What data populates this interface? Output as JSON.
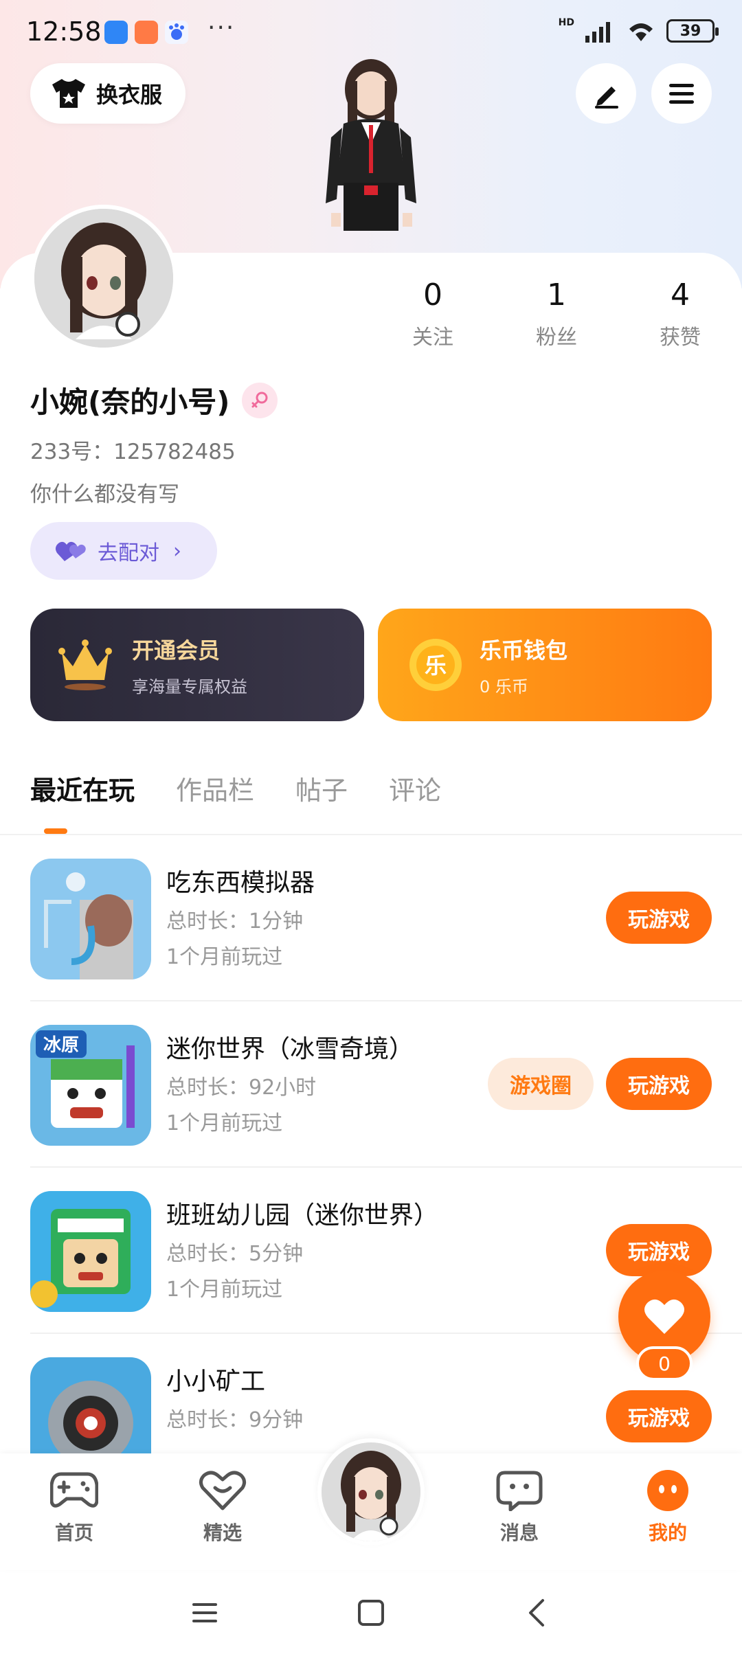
{
  "status_bar": {
    "time": "12:58",
    "dots": "···",
    "network": "HD",
    "battery": "39"
  },
  "header": {
    "dress_button": "换衣服",
    "edit_icon": "edit-icon",
    "menu_icon": "menu-icon"
  },
  "profile": {
    "stats": [
      {
        "num": "0",
        "label": "关注"
      },
      {
        "num": "1",
        "label": "粉丝"
      },
      {
        "num": "4",
        "label": "获赞"
      }
    ],
    "name": "小婉(奈的小号)",
    "uid": "233号：125782485",
    "bio": "你什么都没有写",
    "match_button": "去配对",
    "match_chevron": "›"
  },
  "cards": {
    "vip": {
      "title": "开通会员",
      "subtitle": "享海量专属权益"
    },
    "wallet": {
      "title": "乐币钱包",
      "subtitle": "0 乐币",
      "coin_char": "乐"
    }
  },
  "tabs": [
    "最近在玩",
    "作品栏",
    "帖子",
    "评论"
  ],
  "games": [
    {
      "name": "吃东西模拟器",
      "time": "总时长：1分钟",
      "last": "1个月前玩过",
      "play": "玩游戏",
      "circle": ""
    },
    {
      "name": "迷你世界（冰雪奇境）",
      "time": "总时长：92小时",
      "last": "1个月前玩过",
      "play": "玩游戏",
      "circle": "游戏圈",
      "icon_text": "冰原"
    },
    {
      "name": "班班幼儿园（迷你世界）",
      "time": "总时长：5分钟",
      "last": "1个月前玩过",
      "play": "玩游戏",
      "circle": ""
    },
    {
      "name": "小小矿工",
      "time": "总时长：9分钟",
      "last": "",
      "play": "玩游戏",
      "circle": ""
    }
  ],
  "like_fab": {
    "count": "0"
  },
  "bottom_nav": [
    {
      "label": "首页",
      "icon": "gamepad-icon"
    },
    {
      "label": "精选",
      "icon": "heart-diamond-icon"
    },
    {
      "label": "消息",
      "icon": "chat-icon"
    },
    {
      "label": "我的",
      "icon": "profile-face-icon"
    }
  ],
  "colors": {
    "accent": "#ff6d10",
    "vip_dark": "#2a2837",
    "match_purple": "#6b5ad6"
  }
}
